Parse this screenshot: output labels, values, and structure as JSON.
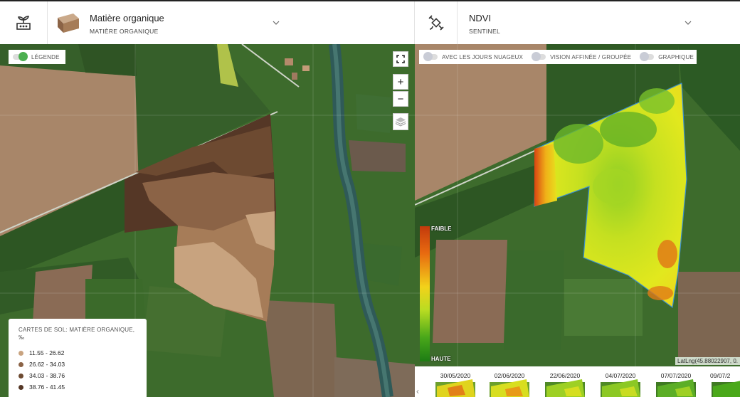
{
  "left_panel": {
    "title": "Matière organique",
    "subtitle": "MATIÈRE ORGANIQUE",
    "legend_toggle_label": "LÉGENDE",
    "legend": {
      "title": "CARTES DE SOL: MATIÈRE ORGANIQUE, ‰",
      "items": [
        {
          "label": "11.55 - 26.62",
          "color": "#c8a37f"
        },
        {
          "label": "26.62 - 34.03",
          "color": "#8b6346"
        },
        {
          "label": "34.03 - 38.76",
          "color": "#6d4a31"
        },
        {
          "label": "38.76 - 41.45",
          "color": "#553726"
        }
      ]
    },
    "controls": {
      "zoom_in": "+",
      "zoom_out": "−"
    }
  },
  "right_panel": {
    "title": "NDVI",
    "subtitle": "SENTINEL",
    "toggles": [
      {
        "label": "AVEC LES JOURS NUAGEUX"
      },
      {
        "label": "VISION AFFINÉE / GROUPÉE"
      },
      {
        "label": "GRAPHIQUE"
      }
    ],
    "scale": {
      "low": "FAIBLE",
      "high": "HAUTE"
    },
    "attribution": "LatLng(45.88022907, 0.",
    "dates": [
      "30/05/2020",
      "02/06/2020",
      "22/06/2020",
      "04/07/2020",
      "07/07/2020",
      "09/07/2"
    ],
    "prev_arrow": "‹"
  },
  "colors": {
    "toggle_on": "#4caf50",
    "toggle_off": "#c9ccd6"
  }
}
